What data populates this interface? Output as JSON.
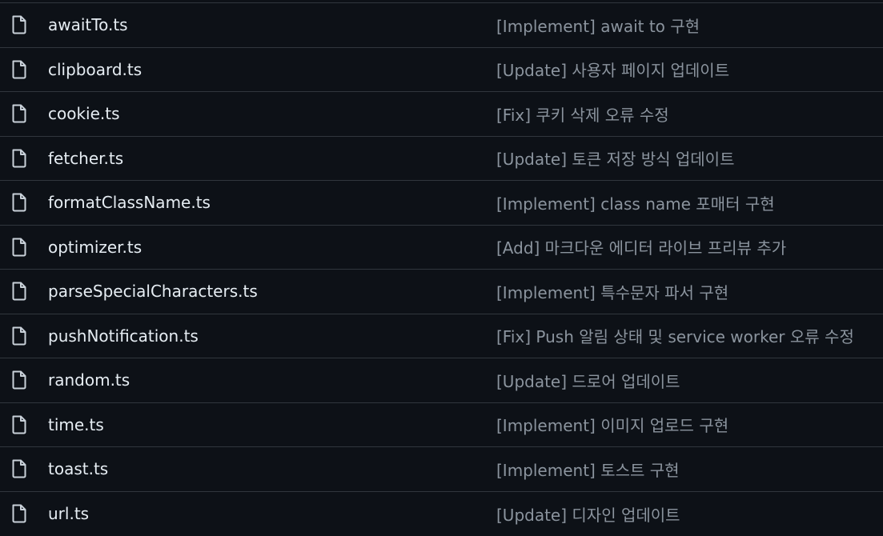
{
  "files": [
    {
      "name": "awaitTo.ts",
      "message": "[Implement] await to 구현"
    },
    {
      "name": "clipboard.ts",
      "message": "[Update] 사용자 페이지 업데이트"
    },
    {
      "name": "cookie.ts",
      "message": "[Fix] 쿠키 삭제 오류 수정"
    },
    {
      "name": "fetcher.ts",
      "message": "[Update] 토큰 저장 방식 업데이트"
    },
    {
      "name": "formatClassName.ts",
      "message": "[Implement] class name 포매터 구현"
    },
    {
      "name": "optimizer.ts",
      "message": "[Add] 마크다운 에디터 라이브 프리뷰 추가"
    },
    {
      "name": "parseSpecialCharacters.ts",
      "message": "[Implement] 특수문자 파서 구현"
    },
    {
      "name": "pushNotification.ts",
      "message": "[Fix] Push 알림 상태 및 service worker 오류 수정"
    },
    {
      "name": "random.ts",
      "message": "[Update] 드로어 업데이트"
    },
    {
      "name": "time.ts",
      "message": "[Implement] 이미지 업로드 구현"
    },
    {
      "name": "toast.ts",
      "message": "[Implement] 토스트 구현"
    },
    {
      "name": "url.ts",
      "message": "[Update] 디자인 업데이트"
    }
  ],
  "icon": "file-icon",
  "colors": {
    "background": "#0d1117",
    "border": "#30363d",
    "file_name": "#e6edf3",
    "commit_message": "#8b949e",
    "icon": "#c9d1d9"
  }
}
